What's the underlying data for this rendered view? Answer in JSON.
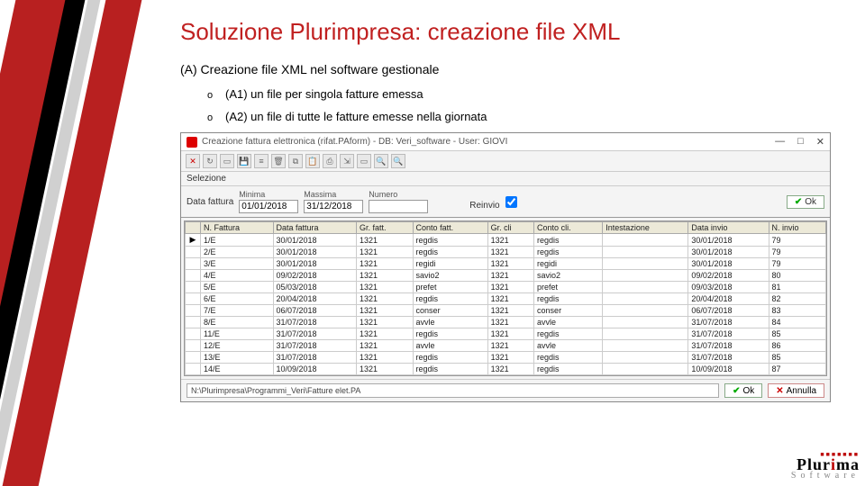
{
  "slide": {
    "title": "Soluzione Plurimpresa: creazione file XML",
    "sectionA": "(A) Creazione file XML nel software gestionale",
    "bullet1": "(A1) un file per singola fatture emessa",
    "bullet2": "(A2) un file di tutte le fatture emesse nella giornata"
  },
  "window": {
    "title": "Creazione fattura elettronica (rifat.PAform) - DB: Veri_software - User: GIOVI",
    "wbtn_min": "—",
    "wbtn_max": "□",
    "wbtn_close": "✕",
    "tab": "Selezione",
    "filter": {
      "label_data": "Data fattura",
      "label_min": "Minima",
      "val_min": "01/01/2018",
      "label_max": "Massima",
      "val_max": "31/12/2018",
      "label_num": "Numero",
      "val_num": "",
      "label_reinvio": "Reinvio",
      "ok": "Ok"
    },
    "cols": [
      "",
      "N. Fattura",
      "Data fattura",
      "Gr. fatt.",
      "Conto fatt.",
      "Gr. cli",
      "Conto cli.",
      "Intestazione",
      "Data invio",
      "N. invio"
    ],
    "rows": [
      [
        "▶",
        "1/E",
        "30/01/2018",
        "1321",
        "regdis",
        "1321",
        "regdis",
        "",
        "30/01/2018",
        "79"
      ],
      [
        "",
        "2/E",
        "30/01/2018",
        "1321",
        "regdis",
        "1321",
        "regdis",
        "",
        "30/01/2018",
        "79"
      ],
      [
        "",
        "3/E",
        "30/01/2018",
        "1321",
        "regidi",
        "1321",
        "regidi",
        "",
        "30/01/2018",
        "79"
      ],
      [
        "",
        "4/E",
        "09/02/2018",
        "1321",
        "savio2",
        "1321",
        "savio2",
        "",
        "09/02/2018",
        "80"
      ],
      [
        "",
        "5/E",
        "05/03/2018",
        "1321",
        "prefet",
        "1321",
        "prefet",
        "",
        "09/03/2018",
        "81"
      ],
      [
        "",
        "6/E",
        "20/04/2018",
        "1321",
        "regdis",
        "1321",
        "regdis",
        "",
        "20/04/2018",
        "82"
      ],
      [
        "",
        "7/E",
        "06/07/2018",
        "1321",
        "conser",
        "1321",
        "conser",
        "",
        "06/07/2018",
        "83"
      ],
      [
        "",
        "8/E",
        "31/07/2018",
        "1321",
        "avvle",
        "1321",
        "avvle",
        "",
        "31/07/2018",
        "84"
      ],
      [
        "",
        "11/E",
        "31/07/2018",
        "1321",
        "regdis",
        "1321",
        "regdis",
        "",
        "31/07/2018",
        "85"
      ],
      [
        "",
        "12/E",
        "31/07/2018",
        "1321",
        "avvle",
        "1321",
        "avvle",
        "",
        "31/07/2018",
        "86"
      ],
      [
        "",
        "13/E",
        "31/07/2018",
        "1321",
        "regdis",
        "1321",
        "regdis",
        "",
        "31/07/2018",
        "85"
      ],
      [
        "",
        "14/E",
        "10/09/2018",
        "1321",
        "regdis",
        "1321",
        "regdis",
        "",
        "10/09/2018",
        "87"
      ]
    ],
    "path": "N:\\Plurimpresa\\Programmi_Veri\\Fatture elet.PA",
    "annulla": "Annulla"
  },
  "brand": {
    "name1": "Plur",
    "nameR": "i",
    "name2": "ma",
    "soft": "Software"
  }
}
